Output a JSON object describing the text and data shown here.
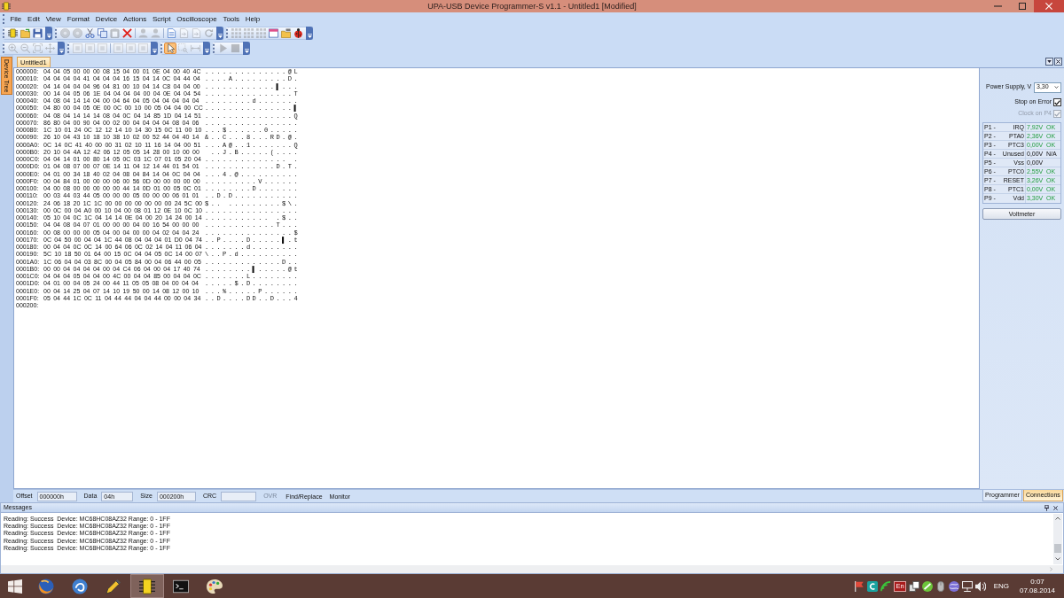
{
  "window": {
    "title": "UPA-USB Device Programmer-S v1.1 - Untitled1 [Modified]"
  },
  "menu": [
    "File",
    "Edit",
    "View",
    "Format",
    "Device",
    "Actions",
    "Script",
    "Oscilloscope",
    "Tools",
    "Help"
  ],
  "toolbar_rows": [
    {
      "toolbars": [
        {
          "groups": [
            [
              {
                "disabled": false
              },
              {
                "disabled": false
              },
              {
                "disabled": false
              }
            ]
          ]
        },
        {
          "groups": [
            [
              {
                "disabled": true
              },
              {
                "disabled": true
              },
              {
                "disabled": false
              },
              {
                "disabled": false
              },
              {
                "disabled": true
              },
              {
                "disabled": false
              }
            ],
            [
              {
                "disabled": true
              },
              {
                "disabled": true
              }
            ],
            [
              {
                "disabled": false
              },
              {
                "disabled": true
              },
              {
                "disabled": true
              },
              {
                "disabled": true
              }
            ]
          ]
        },
        {
          "groups": [
            [
              {
                "disabled": true
              },
              {
                "disabled": true
              },
              {
                "disabled": true
              },
              {
                "disabled": false
              },
              {
                "disabled": false
              },
              {
                "disabled": false
              }
            ]
          ]
        }
      ]
    },
    {
      "toolbars": [
        {
          "groups": [
            [
              {
                "disabled": true
              },
              {
                "disabled": true
              },
              {
                "disabled": true
              },
              {
                "disabled": true
              }
            ]
          ]
        },
        {
          "groups": [
            [
              {
                "disabled": true
              },
              {
                "disabled": true
              },
              {
                "disabled": true
              }
            ],
            [
              {
                "disabled": true
              },
              {
                "disabled": true
              },
              {
                "disabled": true
              }
            ]
          ]
        },
        {
          "groups": [
            [
              {
                "disabled": false,
                "selected": true
              },
              {
                "disabled": true,
                "selected": false
              },
              {
                "disabled": true,
                "selected": false
              }
            ]
          ]
        },
        {
          "groups": [
            [
              {
                "disabled": true
              },
              {
                "disabled": true
              }
            ]
          ]
        }
      ]
    }
  ],
  "side_tab": {
    "label": "Device Tree"
  },
  "document_tabs": [
    {
      "label": "Untitled1",
      "selected": true
    }
  ],
  "hex_rows": [
    {
      "address": "000000:",
      "hex": "04 04 05 00 00 00 08 15 04 00 01 0E 04 00 40 4C",
      "ascii": "..............@L"
    },
    {
      "address": "000010:",
      "hex": "04 04 04 04 41 04 04 04 16 15 04 14 0C 04 44 04",
      "ascii": "....A.........D."
    },
    {
      "address": "000020:",
      "hex": "04 14 04 04 04 96 04 81 00 10 04 14 C8 04 04 00",
      "ascii": "............▌..."
    },
    {
      "address": "000030:",
      "hex": "00 14 04 05 06 1E 04 04 04 04 00 04 0E 04 04 54",
      "ascii": "...............T"
    },
    {
      "address": "000040:",
      "hex": "04 08 04 14 14 04 00 04 64 04 05 04 04 04 04 04",
      "ascii": "........d......."
    },
    {
      "address": "000050:",
      "hex": "04 80 00 04 05 0E 00 0C 00 10 00 05 04 04 00 CC",
      "ascii": "...............▌"
    },
    {
      "address": "000060:",
      "hex": "04 08 04 14 14 14 08 04 0C 04 14 85 1D 04 14 51",
      "ascii": "...............Q"
    },
    {
      "address": "000070:",
      "hex": "86 80 04 00 90 04 00 02 00 04 04 04 04 08 04 06",
      "ascii": "................"
    },
    {
      "address": "000080:",
      "hex": "1C 10 01 24 0C 12 12 14 10 14 30 15 0C 11 00 10",
      "ascii": "...$......0....."
    },
    {
      "address": "000090:",
      "hex": "26 10 04 43 10 18 10 38 10 02 00 52 44 04 40 14",
      "ascii": "&..C...8...RD.@."
    },
    {
      "address": "0000A0:",
      "hex": "0C 14 0C 41 40 00 00 31 02 10 11 16 14 04 00 51",
      "ascii": "...A@..1.......Q"
    },
    {
      "address": "0000B0:",
      "hex": "20 10 04 4A 12 42 06 12 05 05 14 28 00 10 00 00",
      "ascii": " ..J.B.....(...."
    },
    {
      "address": "0000C0:",
      "hex": "04 04 14 01 00 80 14 05 0C 03 1C 07 01 05 20 04",
      "ascii": ".............. ."
    },
    {
      "address": "0000D0:",
      "hex": "01 04 08 07 00 07 0E 14 11 04 12 14 44 01 54 01",
      "ascii": "............D.T."
    },
    {
      "address": "0000E0:",
      "hex": "04 01 00 34 18 40 02 04 08 04 84 14 04 0C 04 04",
      "ascii": "...4.@.........."
    },
    {
      "address": "0000F0:",
      "hex": "00 04 84 01 00 00 00 06 00 56 0D 00 00 00 00 00",
      "ascii": ".........V......"
    },
    {
      "address": "000100:",
      "hex": "04 00 08 00 00 00 00 00 44 14 0D 01 00 05 0C 01",
      "ascii": "........D......."
    },
    {
      "address": "000110:",
      "hex": "00 03 44 03 44 05 00 00 00 05 00 00 00 06 01 01",
      "ascii": "..D.D..........."
    },
    {
      "address": "000120:",
      "hex": "24 06 18 20 1C 1C 00 00 00 00 00 00 00 24 5C 00",
      "ascii": "$.. .........$\\."
    },
    {
      "address": "000130:",
      "hex": "00 0C 00 04 A0 00 10 04 00 08 01 12 0E 10 0C 10",
      "ascii": "................"
    },
    {
      "address": "000140:",
      "hex": "05 10 04 0C 1C 04 14 14 0E 04 00 20 14 24 00 14",
      "ascii": "........... .$.."
    },
    {
      "address": "000150:",
      "hex": "04 04 08 04 07 01 00 00 00 04 00 16 54 00 00 00",
      "ascii": "............T..."
    },
    {
      "address": "000160:",
      "hex": "00 08 00 00 00 05 04 00 04 00 00 04 02 04 04 24",
      "ascii": "...............$"
    },
    {
      "address": "000170:",
      "hex": "0C 04 50 00 04 04 1C 44 08 04 04 04 01 D0 04 74",
      "ascii": "..P....D.....▌.t"
    },
    {
      "address": "000180:",
      "hex": "00 04 04 0C 0C 14 00 64 06 0C 02 14 04 11 06 04",
      "ascii": ".......d........"
    },
    {
      "address": "000190:",
      "hex": "5C 10 18 50 01 64 00 15 0C 04 04 05 0C 14 00 07",
      "ascii": "\\..P.d.........."
    },
    {
      "address": "0001A0:",
      "hex": "1C 06 04 04 03 8C 00 04 05 84 00 04 06 44 00 05",
      "ascii": ".............D.."
    },
    {
      "address": "0001B0:",
      "hex": "00 00 04 04 04 04 00 04 C4 06 04 00 04 17 40 74",
      "ascii": "........▌.....@t"
    },
    {
      "address": "0001C0:",
      "hex": "04 04 04 05 04 04 00 4C 00 04 04 85 00 04 04 0C",
      "ascii": ".......L........"
    },
    {
      "address": "0001D0:",
      "hex": "04 01 00 04 05 24 00 44 11 05 05 08 04 00 04 04",
      "ascii": ".....$.D........"
    },
    {
      "address": "0001E0:",
      "hex": "00 04 14 25 04 07 14 10 19 50 00 14 08 12 00 10",
      "ascii": "...%.....P......"
    },
    {
      "address": "0001F0:",
      "hex": "05 04 44 1C 0C 11 04 44 44 04 04 44 00 00 04 34",
      "ascii": "..D....DD..D...4"
    },
    {
      "address": "000200:"
    }
  ],
  "panel": {
    "power_supply": {
      "label": "Power Supply, V",
      "value": "3,30"
    },
    "options": [
      {
        "label": "Stop on Error",
        "checked": true,
        "disabled": false
      },
      {
        "label": "Clock on P4",
        "checked": true,
        "disabled": true
      }
    ],
    "pins": [
      {
        "pin": "P1 -",
        "signal": "IRQ",
        "voltage": "7,92V",
        "status": "OK",
        "ok": true
      },
      {
        "pin": "P2 -",
        "signal": "PTA0",
        "voltage": "2,36V",
        "status": "OK",
        "ok": true
      },
      {
        "pin": "P3 -",
        "signal": "PTC3",
        "voltage": "0,00V",
        "status": "OK",
        "ok": true
      },
      {
        "pin": "P4 -",
        "signal": "Unused",
        "voltage": "0,00V",
        "status": "N/A",
        "ok": false
      },
      {
        "pin": "P5 -",
        "signal": "Vss",
        "voltage": "0,00V",
        "ok": false
      },
      {
        "pin": "P6 -",
        "signal": "PTC0",
        "voltage": "2,55V",
        "status": "OK",
        "ok": true
      },
      {
        "pin": "P7 -",
        "signal": "RESET",
        "voltage": "3,26V",
        "status": "OK",
        "ok": true
      },
      {
        "pin": "P8 -",
        "signal": "PTC1",
        "voltage": "0,00V",
        "status": "OK",
        "ok": true
      },
      {
        "pin": "P9 -",
        "signal": "Vdd",
        "voltage": "3,30V",
        "status": "OK",
        "ok": true
      }
    ],
    "button": "Voltmeter"
  },
  "status_bar": {
    "fields": [
      {
        "label": "Offset",
        "value": "000000h"
      },
      {
        "label": "Data",
        "value": "04h"
      },
      {
        "label": "Size",
        "value": "000200h"
      },
      {
        "label": "CRC"
      }
    ],
    "ovr": {
      "label": "OVR",
      "active": false
    },
    "buttons": [
      "Find/Replace",
      "Monitor"
    ]
  },
  "panel_tabs": [
    {
      "label": "Programmer",
      "selected": false
    },
    {
      "label": "Connections",
      "selected": true
    }
  ],
  "messages": {
    "title": "Messages",
    "lines": [
      "Reading: Success  Device: MC68HC08AZ32 Range: 0 - 1FF",
      "Reading: Success  Device: MC68HC08AZ32 Range: 0 - 1FF",
      "Reading: Success  Device: MC68HC08AZ32 Range: 0 - 1FF",
      "Reading: Success  Device: MC68HC08AZ32 Range: 0 - 1FF",
      "Reading: Success  Device: MC68HC08AZ32 Range: 0 - 1FF"
    ]
  },
  "taskbar": {
    "apps": [
      {
        "selected": false
      },
      {
        "selected": false
      },
      {
        "selected": false
      },
      {
        "selected": true
      },
      {
        "selected": false
      },
      {
        "selected": false
      }
    ],
    "tray_badge": "En",
    "language": "ENG",
    "time": "0:07",
    "date": "07.08.2014"
  }
}
